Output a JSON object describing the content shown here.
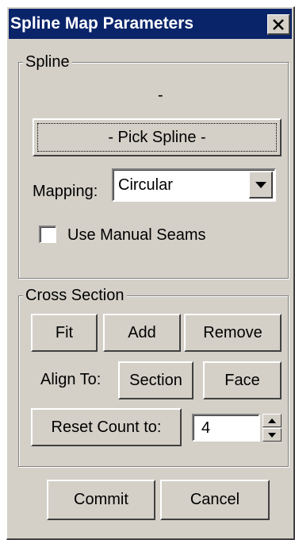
{
  "window": {
    "title": "Spline Map Parameters",
    "close_icon": "close-icon"
  },
  "spline_group": {
    "label": "Spline",
    "current_spline": "-",
    "pick_button": "- Pick Spline -",
    "mapping_label": "Mapping:",
    "mapping_value": "Circular",
    "manual_seams_label": "Use Manual Seams",
    "manual_seams_checked": false
  },
  "cross_section_group": {
    "label": "Cross Section",
    "fit_button": "Fit",
    "add_button": "Add",
    "remove_button": "Remove",
    "align_to_label": "Align To:",
    "section_button": "Section",
    "face_button": "Face",
    "reset_count_button": "Reset Count to:",
    "count_value": "4"
  },
  "footer": {
    "commit_button": "Commit",
    "cancel_button": "Cancel"
  },
  "colors": {
    "titlebar": "#0a246a",
    "face": "#d4d0c8",
    "background": "#ffffff"
  }
}
